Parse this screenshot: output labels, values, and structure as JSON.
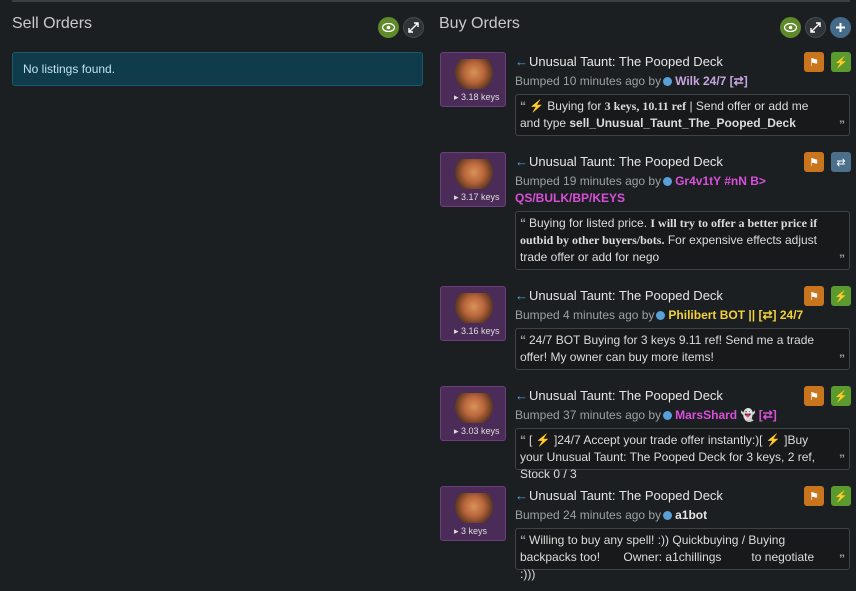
{
  "sell": {
    "title": "Sell Orders",
    "empty_message": "No listings found."
  },
  "buy": {
    "title": "Buy Orders"
  },
  "icons": {
    "eye": "eye-icon",
    "expand": "expand-icon",
    "plus": "plus-icon",
    "flag": "flag-icon",
    "lightning": "lightning-icon",
    "swap": "swap-icon",
    "quote": "quote-icon",
    "key": "key-icon"
  },
  "colors": {
    "accent_green": "#5f8a2b",
    "flag_orange": "#c9751e",
    "notice_bg": "#0f3b4a",
    "user_magenta": "#d94fd9",
    "user_yellow": "#f2cf3c",
    "user_lilac": "#c6a5e0",
    "user_white": "#e6e6e6"
  },
  "orders": [
    {
      "price": "3.18 keys",
      "item": "Unusual Taunt: The Pooped Deck",
      "bumped": "Bumped 10 minutes ago by",
      "user": "Wilk 24/7 [⇄]",
      "user_color": "#c6a5e0",
      "msg_parts": [
        {
          "t": "⚡",
          "c": "bolt"
        },
        {
          "t": " Buying for "
        },
        {
          "t": "3 keys, 10.11 ref",
          "c": "bold-ser"
        },
        {
          "t": " | Send offer or add me and type "
        },
        {
          "t": "sell_Unusual_Taunt_The_Pooped_Deck",
          "c": "uname"
        }
      ],
      "action": "lightning"
    },
    {
      "price": "3.17 keys",
      "item": "Unusual Taunt: The Pooped Deck",
      "bumped": "Bumped 19 minutes ago by",
      "user": "Gr4v1tY #nN B> QS/BULK/BP/KEYS",
      "user_color": "#d94fd9",
      "msg_parts": [
        {
          "t": "Buying for listed price. "
        },
        {
          "t": "I will try to offer a better price if outbid by other buyers/bots.",
          "c": "bold-ser"
        },
        {
          "t": " For expensive effects adjust trade offer or add for nego"
        }
      ],
      "action": "swap"
    },
    {
      "price": "3.16 keys",
      "item": "Unusual Taunt: The Pooped Deck",
      "bumped": "Bumped 4 minutes ago by",
      "user": "Philibert BOT || [⇄] 24/7",
      "user_color": "#f2cf3c",
      "msg_parts": [
        {
          "t": "24/7 BOT Buying for 3 keys 9.11 ref! Send me a trade offer! My owner can buy more items!"
        }
      ],
      "action": "lightning"
    },
    {
      "price": "3.03 keys",
      "item": "Unusual Taunt: The Pooped Deck",
      "bumped": "Bumped 37 minutes ago by",
      "user": "MarsShard 👻 [⇄]",
      "user_color": "#d94fd9",
      "msg_parts": [
        {
          "t": "[ "
        },
        {
          "t": "⚡",
          "c": "bolt"
        },
        {
          "t": " ]24/7 Accept your trade offer instantly:)[ "
        },
        {
          "t": "⚡",
          "c": "bolt"
        },
        {
          "t": " ]Buy your Unusual Taunt: The Pooped Deck for 3 keys, 2 ref, Stock 0 / 3"
        }
      ],
      "action": "lightning"
    },
    {
      "price": "3 keys",
      "item": "Unusual Taunt: The Pooped Deck",
      "bumped": "Bumped 24 minutes ago by",
      "user": "a1bot",
      "user_color": "#e6e6e6",
      "msg_parts": [
        {
          "t": "Willing to buy any spell! :)) Quickbuying / Buying backpacks too!       Owner: a1chillings         to negotiate :)))"
        }
      ],
      "action": "lightning"
    }
  ]
}
